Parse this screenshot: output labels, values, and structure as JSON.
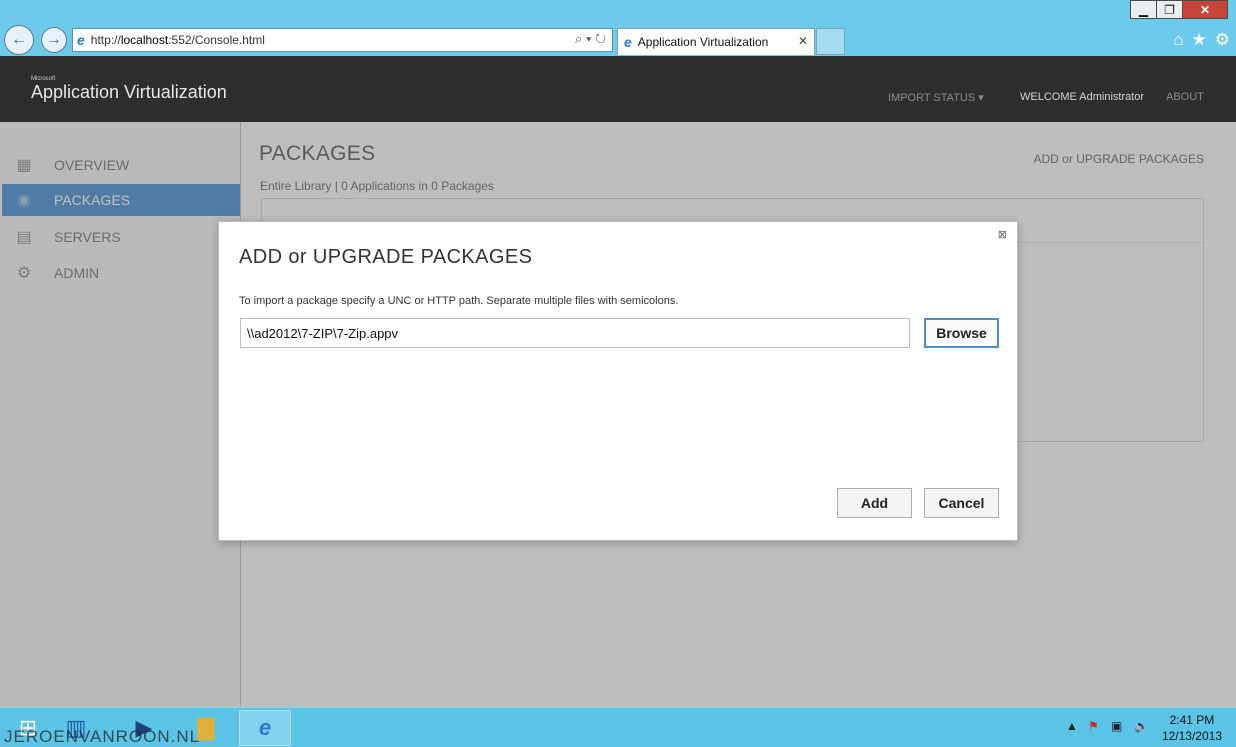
{
  "browser": {
    "address": {
      "prefix": "http://",
      "host": "localhost",
      "rest": ":552/Console.html"
    },
    "tab_title": "Application Virtualization",
    "window_controls": {
      "minimize": "▁",
      "restore": "❐",
      "close": "✕"
    }
  },
  "app": {
    "brand_small": "Microsoft",
    "brand": "Application Virtualization",
    "header_nav": {
      "import_status": "IMPORT STATUS ▾",
      "welcome": "WELCOME Administrator",
      "about": "ABOUT"
    }
  },
  "sidebar": {
    "items": [
      {
        "label": "OVERVIEW",
        "icon": "overview-grid-icon",
        "active": false
      },
      {
        "label": "PACKAGES",
        "icon": "packages-icon",
        "active": true
      },
      {
        "label": "SERVERS",
        "icon": "servers-icon",
        "active": false
      },
      {
        "label": "ADMIN",
        "icon": "gear-icon",
        "active": false
      }
    ]
  },
  "main": {
    "title": "PACKAGES",
    "subtitle": "Entire Library | 0 Applications in 0 Packages",
    "add_link": "ADD or UPGRADE PACKAGES"
  },
  "dialog": {
    "title": "ADD or UPGRADE PACKAGES",
    "instruction": "To import a package specify a UNC or HTTP path. Separate multiple files with semicolons.",
    "path_value": "\\\\ad2012\\7-ZIP\\7-Zip.appv",
    "browse_label": "Browse",
    "add_label": "Add",
    "cancel_label": "Cancel",
    "close_glyph": "⊠"
  },
  "taskbar": {
    "watermark": "JEROENVANROON.NL",
    "clock_time": "2:41 PM",
    "clock_date": "12/13/2013"
  },
  "colors": {
    "accent": "#1f75c8",
    "header_bg": "#2d2d2d",
    "taskbar": "#5bc3e6"
  }
}
